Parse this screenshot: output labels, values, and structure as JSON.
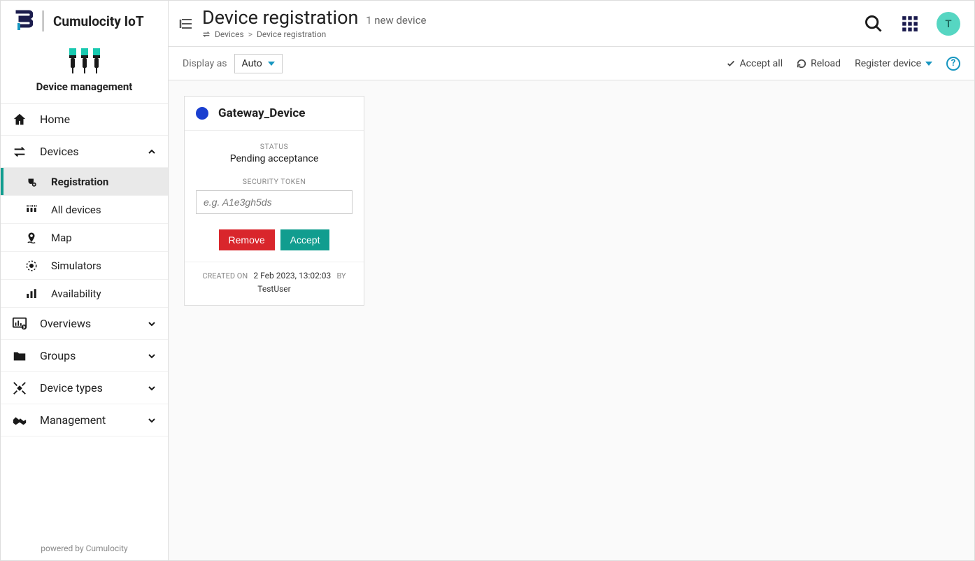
{
  "brand": {
    "name": "Cumulocity IoT"
  },
  "module": {
    "title": "Device management"
  },
  "sidebar": {
    "home": "Home",
    "devices": {
      "label": "Devices",
      "expanded": true
    },
    "registration": "Registration",
    "allDevices": "All devices",
    "map": "Map",
    "simulators": "Simulators",
    "availability": "Availability",
    "overviews": "Overviews",
    "groups": "Groups",
    "deviceTypes": "Device types",
    "management": "Management",
    "footer": "powered by Cumulocity"
  },
  "header": {
    "title": "Device registration",
    "subtitle": "1 new device",
    "breadcrumb": {
      "root": "Devices",
      "current": "Device registration"
    },
    "avatar": "T"
  },
  "toolbar": {
    "displayAs": "Display as",
    "displayValue": "Auto",
    "acceptAll": "Accept all",
    "reload": "Reload",
    "registerDevice": "Register device"
  },
  "card": {
    "name": "Gateway_Device",
    "statusLabel": "STATUS",
    "statusValue": "Pending acceptance",
    "tokenLabel": "SECURITY TOKEN",
    "tokenPlaceholder": "e.g. A1e3gh5ds",
    "removeLabel": "Remove",
    "acceptLabel": "Accept",
    "createdOnLabel": "CREATED ON",
    "createdOnValue": "2 Feb 2023, 13:02:03",
    "byLabel": "BY",
    "byValue": "TestUser"
  }
}
